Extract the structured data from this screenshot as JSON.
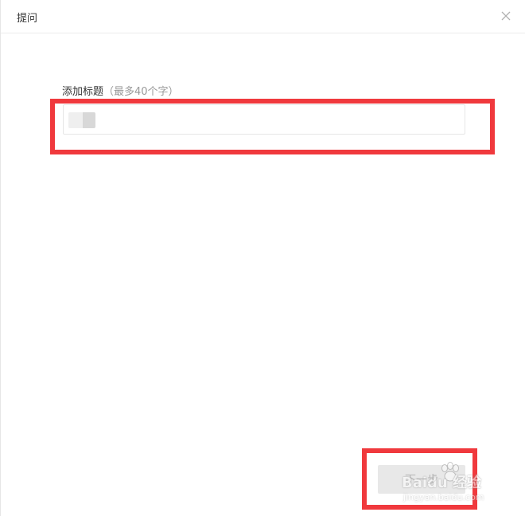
{
  "dialog": {
    "title": "提问",
    "close_icon": "close-icon"
  },
  "form": {
    "label": "添加标题",
    "hint": "（最多40个字）",
    "title_input_value": ""
  },
  "footer": {
    "next_label": "下一步"
  },
  "watermark": {
    "brand": "Baidu 经验",
    "url": "jingyan.baidu.com"
  },
  "colors": {
    "highlight": "#f0393d",
    "button_bg": "#e8e8e8",
    "button_text": "#b5b5b5"
  }
}
